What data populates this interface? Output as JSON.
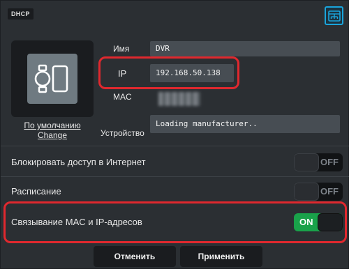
{
  "header": {
    "tag": "DHCP",
    "network_icon": "network-map-icon"
  },
  "device": {
    "icon": "device-combo-icon",
    "link_default": "По умолчанию",
    "link_change": "Change"
  },
  "fields": {
    "name_label": "Имя",
    "name_value": "DVR",
    "ip_label": "IP",
    "ip_value": "192.168.50.138",
    "mac_label": "MAC",
    "mac_value": "",
    "manufacturer_label": "Устройство",
    "manufacturer_value": "Loading manufacturer.."
  },
  "settings": [
    {
      "label": "Блокировать доступ в Интернет",
      "state": "OFF"
    },
    {
      "label": "Расписание",
      "state": "OFF"
    },
    {
      "label": "Связывание MAC и IP-адресов",
      "state": "ON"
    }
  ],
  "actions": {
    "cancel": "Отменить",
    "apply": "Применить"
  },
  "colors": {
    "background": "#2b2f33",
    "highlight": "#e0282e",
    "toggle_on": "#19a24a",
    "accent": "#1aa5dc"
  }
}
